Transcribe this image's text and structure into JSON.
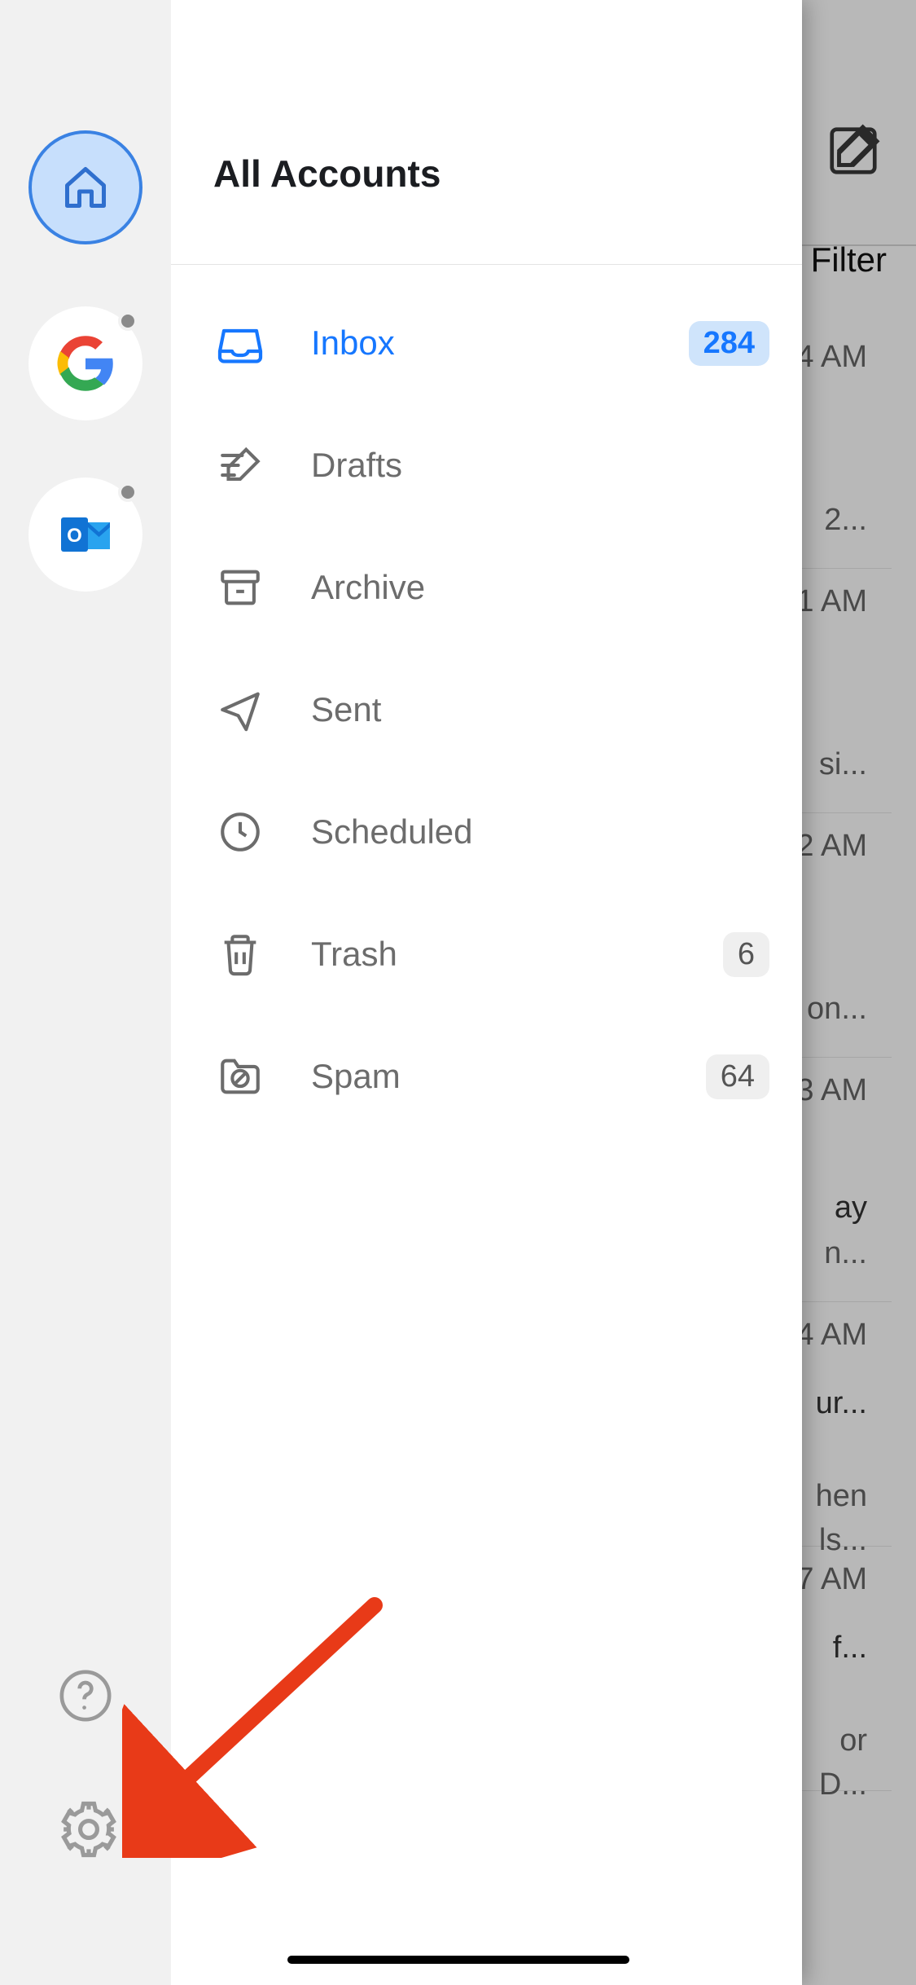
{
  "background": {
    "filter_label": "Filter",
    "compose_icon_name": "compose-icon",
    "rows": [
      {
        "time": "4 AM",
        "snippet1": "",
        "snippet2": "2..."
      },
      {
        "time": "1 AM",
        "snippet1": "",
        "snippet2": "si..."
      },
      {
        "time": "2 AM",
        "snippet1": "",
        "snippet2": "on..."
      },
      {
        "time": "3 AM",
        "snippet1": "ay",
        "snippet2": "n..."
      },
      {
        "time": "4 AM",
        "snippet1": "ur...",
        "snippet2": "hen",
        "snippet3": "ls..."
      },
      {
        "time": "7 AM",
        "snippet1": "f...",
        "snippet2": "or",
        "snippet3": "D..."
      }
    ]
  },
  "drawer": {
    "title": "All Accounts",
    "accounts": {
      "home": {
        "name": "home-account",
        "selected": true
      },
      "google": {
        "name": "google-account",
        "selected": false
      },
      "outlook": {
        "name": "outlook-account",
        "selected": false
      }
    },
    "folders": [
      {
        "key": "inbox",
        "label": "Inbox",
        "count": "284",
        "active": true
      },
      {
        "key": "drafts",
        "label": "Drafts",
        "count": "",
        "active": false
      },
      {
        "key": "archive",
        "label": "Archive",
        "count": "",
        "active": false
      },
      {
        "key": "sent",
        "label": "Sent",
        "count": "",
        "active": false
      },
      {
        "key": "scheduled",
        "label": "Scheduled",
        "count": "",
        "active": false
      },
      {
        "key": "trash",
        "label": "Trash",
        "count": "6",
        "active": false
      },
      {
        "key": "spam",
        "label": "Spam",
        "count": "64",
        "active": false
      }
    ],
    "rail_buttons": {
      "help": {
        "name": "help-icon"
      },
      "settings": {
        "name": "gear-icon"
      }
    }
  },
  "annotation": {
    "arrow_target": "settings-button",
    "arrow_color": "#e83a18"
  },
  "colors": {
    "accent": "#1677ff",
    "rail_bg": "#f1f1f1",
    "home_fill": "#c7dffc",
    "home_stroke": "#3a82e3",
    "badge_primary_bg": "#cfe4fb",
    "muted_text": "#6c6c6c"
  }
}
